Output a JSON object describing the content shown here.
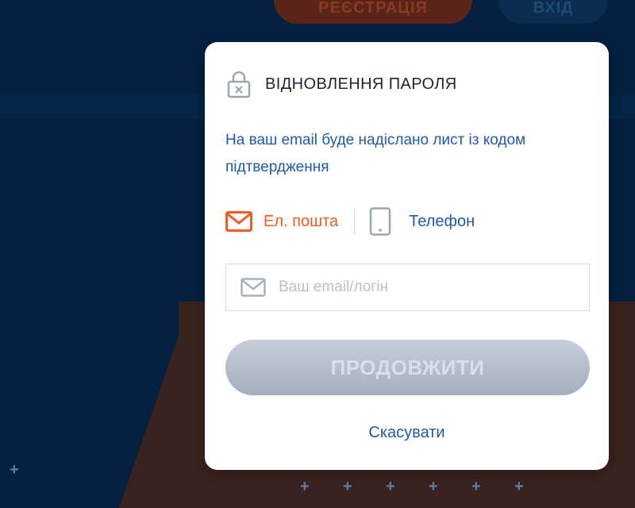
{
  "header": {
    "register_label": "РЕЄСТРАЦІЯ",
    "login_label": "ВХІД"
  },
  "modal": {
    "title": "ВІДНОВЛЕННЯ ПАРОЛЯ",
    "description": "На ваш email буде надіслано лист із кодом підтвердження",
    "methods": [
      {
        "label": "Ел. пошта",
        "icon": "mail-icon",
        "active": true,
        "color": "#f25a22"
      },
      {
        "label": "Телефон",
        "icon": "phone-icon",
        "active": false,
        "color": "#1f5aa8"
      }
    ],
    "email_field": {
      "placeholder": "Ваш email/логін",
      "value": ""
    },
    "continue_label": "ПРОДОВЖИТИ",
    "cancel_label": "Скасувати"
  },
  "colors": {
    "background": "#04213f",
    "accent_orange": "#f25a22",
    "link_blue": "#1f5aa8",
    "disabled_button": "#b4bdc9"
  }
}
